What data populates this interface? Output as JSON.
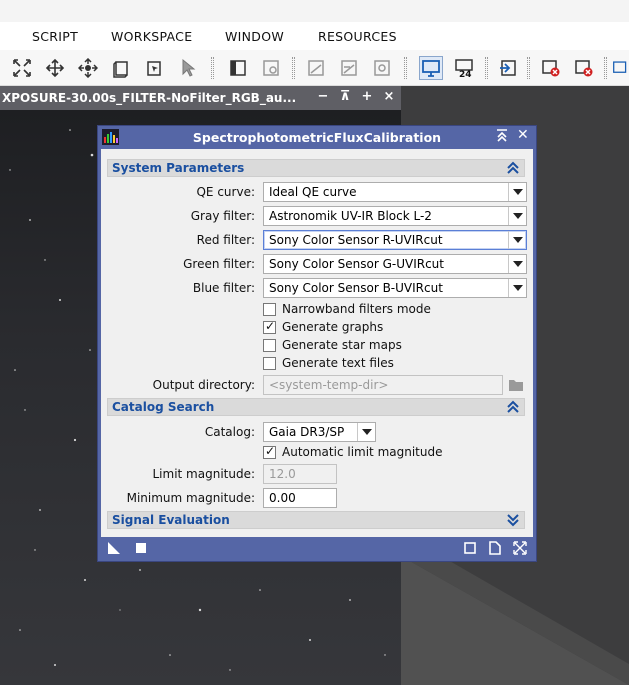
{
  "menu": [
    "SCRIPT",
    "WORKSPACE",
    "WINDOW",
    "RESOURCES"
  ],
  "image_window": {
    "title": "XPOSURE-30.00s_FILTER-NoFilter_RGB_au...",
    "controls": [
      "−",
      "⊼",
      "+",
      "×"
    ]
  },
  "dialog": {
    "title": "SpectrophotometricFluxCalibration",
    "sections": {
      "system": "System Parameters",
      "catalog": "Catalog Search",
      "signal": "Signal Evaluation"
    },
    "fields": {
      "qe_label": "QE curve:",
      "qe_value": "Ideal QE curve",
      "gray_label": "Gray filter:",
      "gray_value": "Astronomik UV-IR Block L-2",
      "red_label": "Red filter:",
      "red_value": "Sony Color Sensor R-UVIRcut",
      "green_label": "Green filter:",
      "green_value": "Sony Color Sensor G-UVIRcut",
      "blue_label": "Blue filter:",
      "blue_value": "Sony Color Sensor B-UVIRcut",
      "output_label": "Output directory:",
      "output_placeholder": "<system-temp-dir>",
      "catalog_label": "Catalog:",
      "catalog_value": "Gaia DR3/SP",
      "limit_label": "Limit magnitude:",
      "limit_value": "12.0",
      "minmag_label": "Minimum magnitude:",
      "minmag_value": "0.00"
    },
    "checkboxes": {
      "narrowband": {
        "label": "Narrowband filters mode",
        "checked": false
      },
      "graphs": {
        "label": "Generate graphs",
        "checked": true
      },
      "starmaps": {
        "label": "Generate star maps",
        "checked": false
      },
      "textfiles": {
        "label": "Generate text files",
        "checked": false
      },
      "autolimit": {
        "label": "Automatic limit magnitude",
        "checked": true
      }
    },
    "check_glyph": "✓"
  },
  "colors": {
    "dialog_frame": "#5566a6",
    "section_title": "#1a4fa0",
    "image_title_bar": "#5f5f65"
  }
}
